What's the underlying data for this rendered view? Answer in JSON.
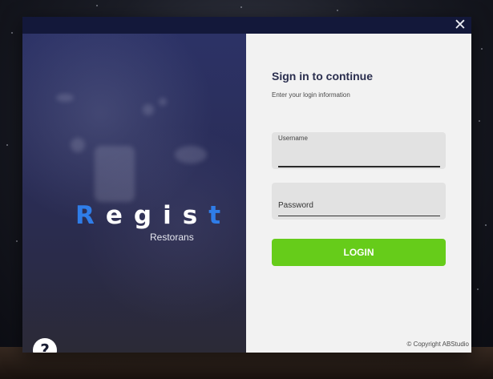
{
  "window": {
    "close_glyph": "✕"
  },
  "branding": {
    "logo_letters": [
      "R",
      "e",
      "g",
      "i",
      "s",
      "t"
    ],
    "subtitle": "Restorans",
    "colors": {
      "blue": "#2f7de8",
      "red_dot": "#ff3030"
    }
  },
  "form": {
    "title": "Sign in to continue",
    "subtitle": "Enter your login information",
    "username_label": "Username",
    "username_value": "",
    "password_label": "Password",
    "password_value": "",
    "login_label": "LOGIN",
    "login_color": "#66cc1a"
  },
  "help": {
    "glyph": "?"
  },
  "footer": {
    "copyright": "© Copyright ABStudio"
  }
}
